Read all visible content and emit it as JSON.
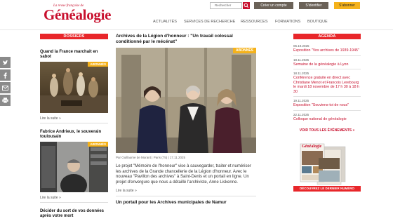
{
  "header": {
    "logo_small": "La revue française de",
    "logo_main": "Généalogie",
    "search_placeholder": "Rechercher",
    "create_account": "Créer un compte",
    "login": "S'identifier",
    "subscribe": "S'abonner",
    "nav": [
      "ACTUALITÉS",
      "SERVICES DE RECHERCHE",
      "RESSOURCES",
      "FORMATIONS",
      "BOUTIQUE"
    ]
  },
  "dossiers": {
    "heading": "DOSSIERS",
    "items": [
      {
        "title": "Quand la France marchait en sabot",
        "badge": "ABONNÉS",
        "readmore": "Lire la suite »"
      },
      {
        "title": "Fabrice Andrieux, le souverain toulousain",
        "badge": "ABONNÉS",
        "readmore": "Lire la suite »"
      },
      {
        "title": "Décider du sort de vos données après votre mort"
      }
    ]
  },
  "main": {
    "title": "Archives de la Légion d'honneur : \"Un travail colossal conditionné par le mécénat\"",
    "badge": "ABONNÉS",
    "byline": "Par Guillaume de Morant  |  Paris (75)  |  17.11.2025",
    "text": "Le projet \"Mémoire de l'honneur\" vise à sauvegarder, traiter et numériser les archives de la Grande chancellerie de la Légion d'honneur. Avec le nouveau \"Pavillon des archives\" à Saint-Denis et un portail en ligne. Un projet d'envergure que nous a détaillé l'archiviste, Anne Liskenne.",
    "readmore": "Lire la suite »",
    "next_title": "Un portail pour les Archives municipales de Namur"
  },
  "agenda": {
    "heading": "AGENDA",
    "items": [
      {
        "date": "06.10.2025",
        "text": "Exposition \"Vos archives de 1939-1945\""
      },
      {
        "date": "18.11.2025",
        "text": "Semaine de la généalogie à Lyon"
      },
      {
        "date": "18.11.2025",
        "text": "Conférence gratuite en direct avec Christiane Menot et Francois Lerebourg le mardi 18 novembre de 17 h 30 à 18 h 30"
      },
      {
        "date": "19.11.2025",
        "text": "Exposition \"Souviens-toi de nous\""
      },
      {
        "date": "22.11.2025",
        "text": "Colloque national de généalogie"
      }
    ],
    "all_events": "VOIR TOUS LES ÉVÉNEMENTS »",
    "mag_label": "Généalogie",
    "mag_caption": "DÉCOUVREZ LE DERNIER NUMÉRO"
  },
  "colors": {
    "accent": "#e8262a",
    "brand": "#c8102e",
    "gold": "#f5b21b",
    "grey": "#6b6258"
  }
}
